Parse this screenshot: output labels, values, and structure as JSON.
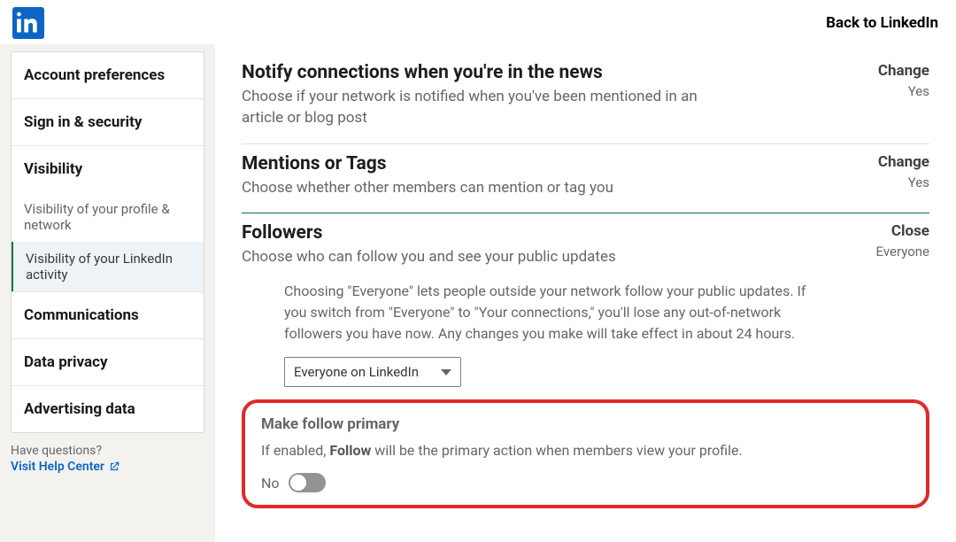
{
  "header": {
    "back_label": "Back to LinkedIn"
  },
  "sidebar": {
    "sections": {
      "account": "Account preferences",
      "signin": "Sign in & security",
      "visibility": "Visibility",
      "communications": "Communications",
      "data_privacy": "Data privacy",
      "advertising": "Advertising data"
    },
    "sub": {
      "profile_network": "Visibility of your profile & network",
      "activity": "Visibility of your LinkedIn activity"
    },
    "footer_question": "Have questions?",
    "footer_link": "Visit Help Center"
  },
  "settings": {
    "news": {
      "title": "Notify connections when you're in the news",
      "desc": "Choose if your network is notified when you've been mentioned in an article or blog post",
      "action": "Change",
      "value": "Yes"
    },
    "mentions": {
      "title": "Mentions or Tags",
      "desc": "Choose whether other members can mention or tag you",
      "action": "Change",
      "value": "Yes"
    },
    "followers": {
      "title": "Followers",
      "desc": "Choose who can follow you and see your public updates",
      "action": "Close",
      "value": "Everyone",
      "explain": "Choosing \"Everyone\" lets people outside your network follow your public updates. If you switch from \"Everyone\" to \"Your connections,\" you'll lose any out-of-network followers you have now. Any changes you make will take effect in about 24 hours.",
      "select_value": "Everyone on LinkedIn",
      "make_primary_title": "Make follow primary",
      "make_primary_desc_pre": "If enabled, ",
      "make_primary_desc_bold": "Follow",
      "make_primary_desc_post": " will be the primary action when members view your profile.",
      "toggle_label": "No",
      "toggle_on": false
    }
  }
}
